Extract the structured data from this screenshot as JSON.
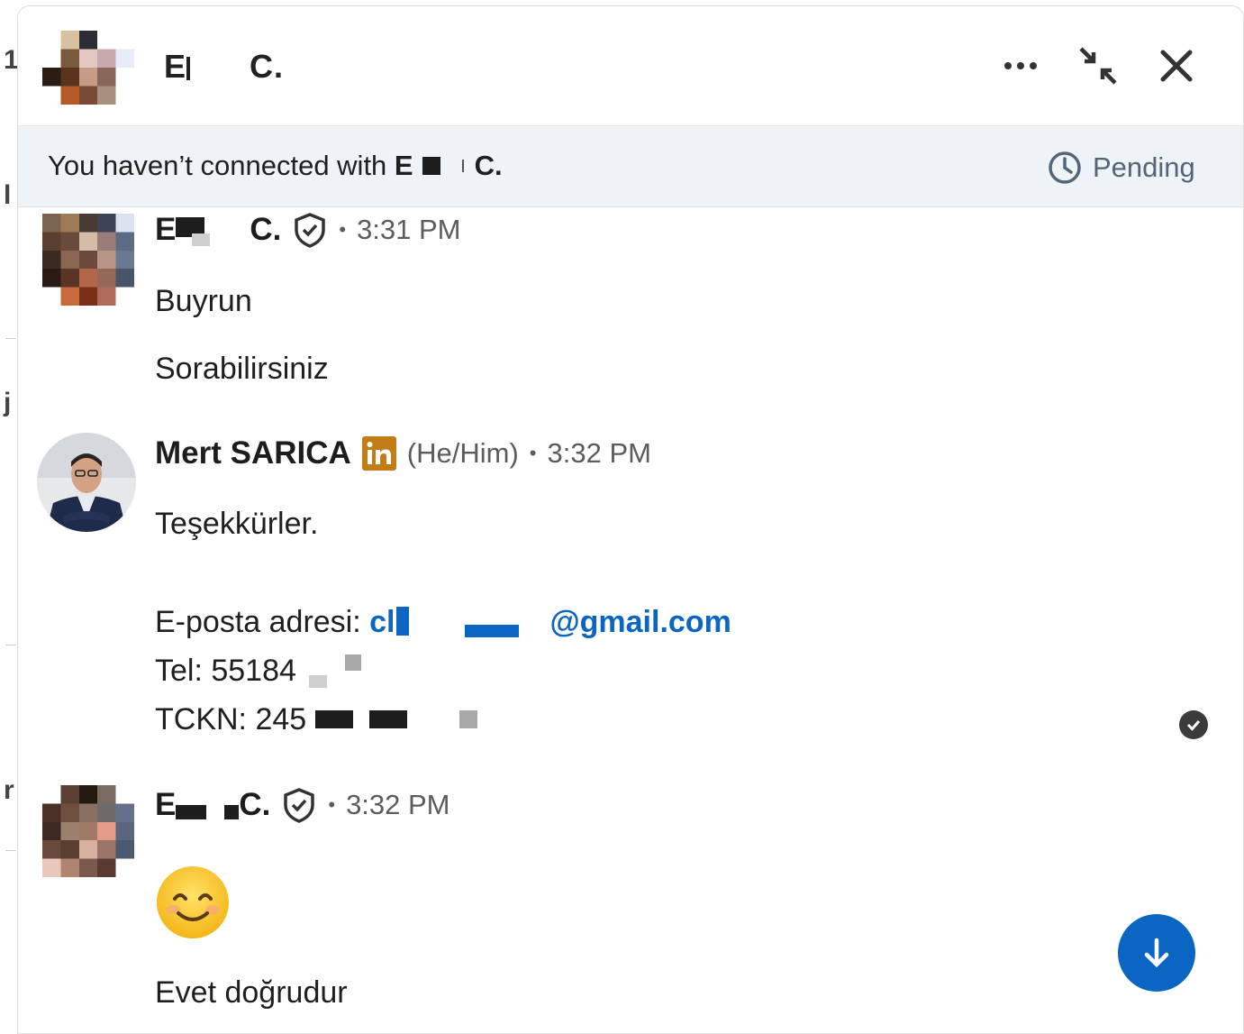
{
  "window": {
    "contact_name_prefix": "E",
    "contact_name_suffix": "C.",
    "more_icon": "more-horizontal-icon",
    "minimize_icon": "collapse-arrows-icon",
    "close_icon": "close-icon"
  },
  "banner": {
    "text": "You haven’t connected with ",
    "name_prefix": "E",
    "name_suffix": "C.",
    "status_label": "Pending",
    "status_icon": "clock-icon"
  },
  "messages": [
    {
      "sender_prefix": "E",
      "sender_suffix": "C.",
      "badge_icon": "verified-shield-icon",
      "separator": "•",
      "time": "3:31 PM",
      "lines": [
        "Buyrun",
        "Sorabilirsiniz"
      ]
    },
    {
      "sender": "Mert SARICA",
      "badge_icon": "linkedin-premium-icon",
      "pronouns": "(He/Him)",
      "separator": "•",
      "time": "3:32 PM",
      "lines": [
        "Teşekkürler."
      ],
      "email_label": "E-posta adresi: ",
      "email_prefix": "cl",
      "email_suffix": "@gmail.com",
      "tel_label": "Tel: 55184",
      "tckn_label": "TCKN: 245"
    },
    {
      "sender_prefix": "E",
      "sender_suffix": "C.",
      "badge_icon": "verified-shield-icon",
      "separator": "•",
      "time": "3:32 PM",
      "emoji": "smiling-face-emoji",
      "lines": [
        "Evet doğrudur"
      ]
    }
  ],
  "colors": {
    "link": "#0a66c2",
    "banner_bg": "#eef3f8",
    "scroll_button": "#0a66c2",
    "premium_badge": "#c37d16"
  }
}
